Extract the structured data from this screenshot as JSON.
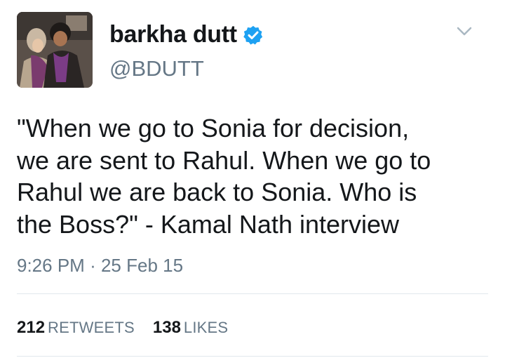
{
  "user": {
    "display_name": "barkha dutt",
    "handle": "@BDUTT",
    "verified_icon": "verified-badge-icon",
    "verified_color": "#1da1f2"
  },
  "tweet": {
    "text": "\"When we go to Sonia for decision,\nwe are sent to Rahul. When we go to\nRahul we are back  to Sonia. Who is\nthe Boss?\" - Kamal Nath interview",
    "time": "9:26 PM",
    "separator": "·",
    "date": "25 Feb 15"
  },
  "stats": {
    "retweets_count": "212",
    "retweets_label": "RETWEETS",
    "likes_count": "138",
    "likes_label": "LIKES"
  },
  "menu": {
    "icon": "chevron-down-icon"
  }
}
